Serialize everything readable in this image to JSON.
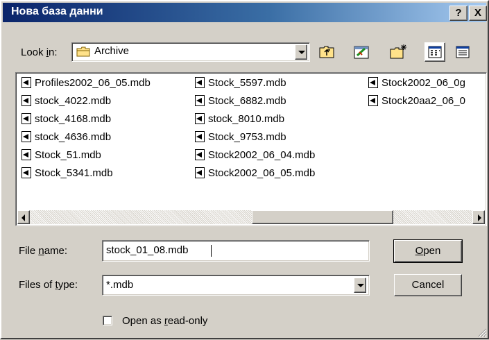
{
  "window": {
    "title": "Нова база данни"
  },
  "caption_buttons": {
    "help": "?",
    "close": "X"
  },
  "look_in": {
    "label_pre": "Look ",
    "label_key": "i",
    "label_post": "n:",
    "value": "Archive",
    "folder_icon": "folder-icon"
  },
  "toolbar": {
    "icons": [
      "up-one-level-icon",
      "favorites-icon",
      "create-new-folder-icon",
      "list-view-icon",
      "details-view-icon"
    ]
  },
  "files": {
    "column1": [
      "Profiles2002_06_05.mdb",
      "stock_4022.mdb",
      "stock_4168.mdb",
      "stock_4636.mdb",
      "Stock_51.mdb",
      "Stock_5341.mdb"
    ],
    "column2": [
      "Stock_5597.mdb",
      "Stock_6882.mdb",
      "stock_8010.mdb",
      "Stock_9753.mdb",
      "Stock2002_06_04.mdb",
      "Stock2002_06_05.mdb"
    ],
    "column3": [
      "Stock2002_06_0g",
      "Stock20aa2_06_0"
    ]
  },
  "file_name": {
    "label_pre": "File ",
    "label_key": "n",
    "label_post": "ame:",
    "value": "stock_01_08.mdb"
  },
  "file_type": {
    "label_pre": "Files of ",
    "label_key": "t",
    "label_post": "ype:",
    "value": "*.mdb"
  },
  "buttons": {
    "open_key": "O",
    "open_rest": "pen",
    "cancel": "Cancel"
  },
  "read_only": {
    "label_pre": "Open as ",
    "label_key": "r",
    "label_post": "ead-only",
    "checked": false
  }
}
